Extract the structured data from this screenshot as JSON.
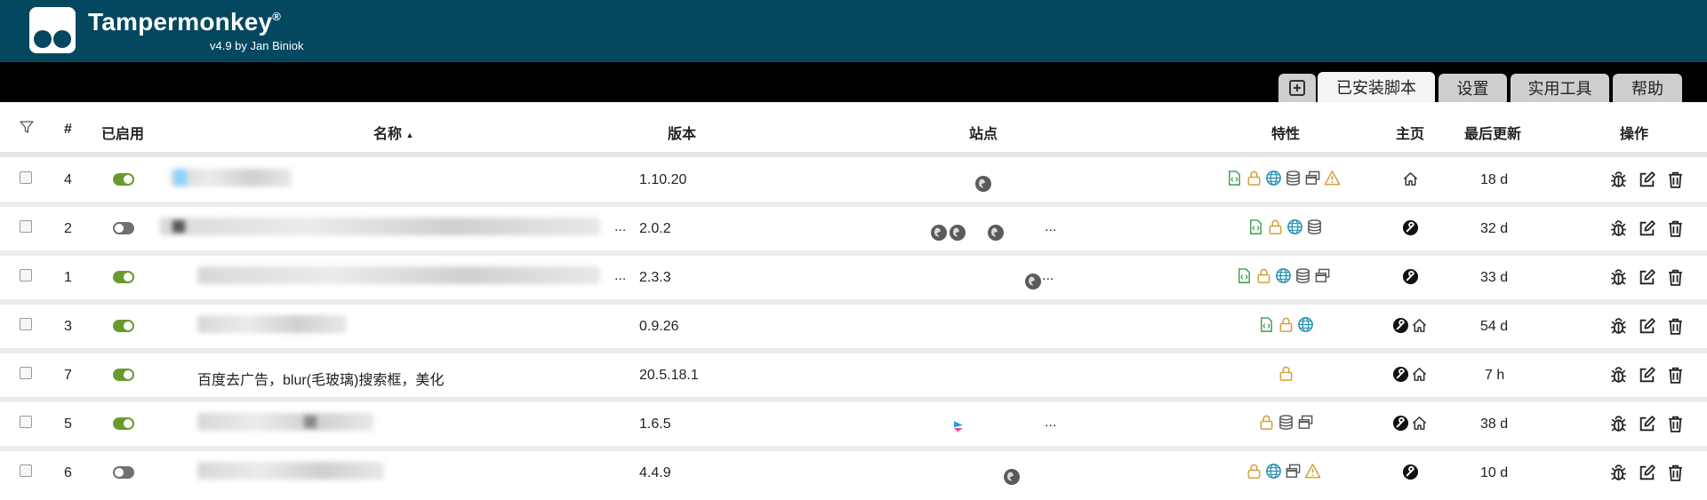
{
  "header": {
    "app_name": "Tampermonkey",
    "reg_mark": "®",
    "byline": "v4.9 by Jan Biniok"
  },
  "tabs": [
    {
      "label": "已安装脚本",
      "active": true
    },
    {
      "label": "设置",
      "active": false
    },
    {
      "label": "实用工具",
      "active": false
    },
    {
      "label": "帮助",
      "active": false
    }
  ],
  "table": {
    "headers": {
      "num": "#",
      "enabled": "已启用",
      "name": "名称",
      "sort_indicator": "▲",
      "version": "版本",
      "sites": "站点",
      "features": "特性",
      "homepage": "主页",
      "last_updated": "最后更新",
      "actions": "操作"
    },
    "rows": [
      {
        "num": "4",
        "enabled": true,
        "name": "",
        "version": "1.10.20",
        "sites_more": "",
        "updated": "18 d"
      },
      {
        "num": "2",
        "enabled": false,
        "name": "",
        "name_more": "...",
        "version": "2.0.2",
        "sites_more": "...",
        "updated": "32 d"
      },
      {
        "num": "1",
        "enabled": true,
        "name": "",
        "name_more": "...",
        "version": "2.3.3",
        "sites_more": "...",
        "updated": "33 d"
      },
      {
        "num": "3",
        "enabled": true,
        "name": "",
        "version": "0.9.26",
        "sites_more": "",
        "updated": "54 d"
      },
      {
        "num": "7",
        "enabled": true,
        "name": "百度去广告，blur(毛玻璃)搜索框，美化",
        "version": "20.5.18.1",
        "sites_more": "",
        "updated": "7 h"
      },
      {
        "num": "5",
        "enabled": true,
        "name": "",
        "version": "1.6.5",
        "sites_more": "...",
        "updated": "38 d"
      },
      {
        "num": "6",
        "enabled": false,
        "name": "",
        "version": "4.4.9",
        "sites_more": "",
        "updated": "10 d"
      }
    ]
  },
  "icons": {
    "filter": "filter-icon",
    "feature_script": "script-file-icon",
    "feature_lock": "lock-icon",
    "feature_web": "globe-icon",
    "feature_storage": "database-icon",
    "feature_windows": "windows-icon",
    "feature_warning": "warning-icon",
    "homepage": "home-icon",
    "homepage_alt": "wrench-icon",
    "action_debug": "bug-icon",
    "action_edit": "edit-icon",
    "action_delete": "trash-icon"
  },
  "colors": {
    "header_bg": "#04485f",
    "toggle_on": "#6a9a2e",
    "toggle_off": "#707070",
    "lock": "#d5a13a",
    "script": "#3d9a4e",
    "web": "#1f8fb0",
    "warning": "#d5a13a"
  }
}
